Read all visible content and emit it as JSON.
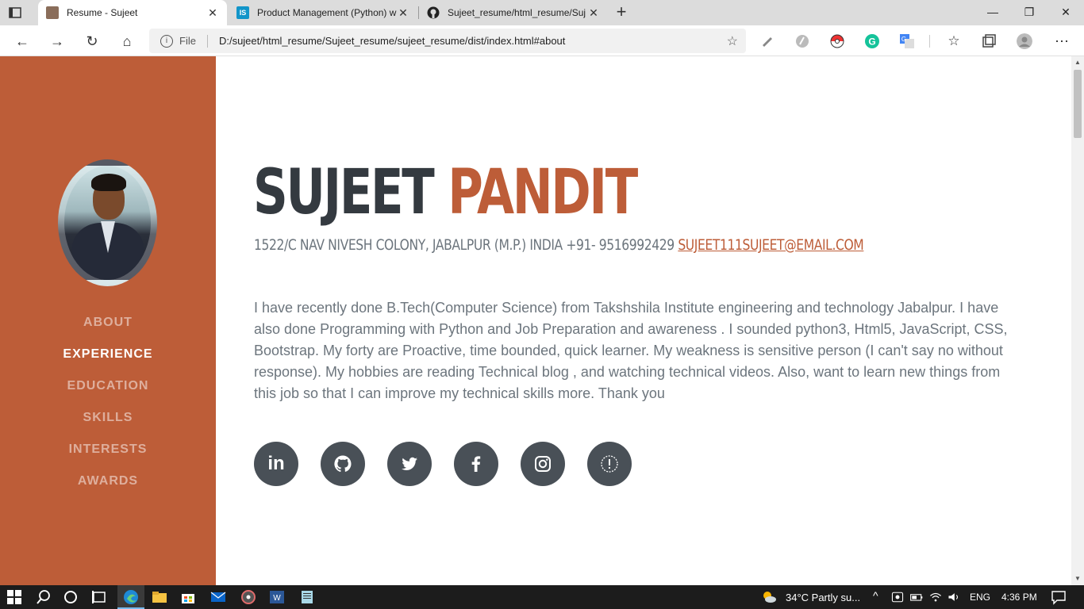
{
  "browser": {
    "tabs": [
      {
        "title": "Resume - Sujeet",
        "active": true
      },
      {
        "title": "Product Management (Python) w",
        "active": false
      },
      {
        "title": "Sujeet_resume/html_resume/Suj",
        "active": false
      }
    ],
    "new_tab": "+",
    "address": {
      "scheme_label": "File",
      "url": "D:/sujeet/html_resume/Sujeet_resume/sujeet_resume/dist/index.html#about"
    },
    "window_controls": {
      "minimize": "—",
      "restore": "❐",
      "close": "✕"
    }
  },
  "sidebar": {
    "nav": [
      {
        "label": "ABOUT",
        "active": false
      },
      {
        "label": "EXPERIENCE",
        "active": true
      },
      {
        "label": "EDUCATION",
        "active": false
      },
      {
        "label": "SKILLS",
        "active": false
      },
      {
        "label": "INTERESTS",
        "active": false
      },
      {
        "label": "AWARDS",
        "active": false
      }
    ]
  },
  "about": {
    "first_name": "SUJEET",
    "last_name": "PANDIT",
    "address": "1522/C NAV NIVESH COLONY, JABALPUR (M.P.) INDIA +91- 9516992429",
    "email": "SUJEET111SUJEET@EMAIL.COM",
    "bio": "I have recently done B.Tech(Computer Science) from Takshshila Institute engineering and technology Jabalpur. I have also done Programming with Python and Job Preparation and awareness . I sounded python3, Html5, JavaScript, CSS, Bootstrap. My forty are Proactive, time bounded, quick learner. My weakness is sensitive person (I can't say no without response). My hobbies are reading Technical blog , and watching technical videos. Also, want to learn new things from this job so that I can improve my technical skills more. Thank you",
    "socials": [
      "linkedin-icon",
      "github-icon",
      "twitter-icon",
      "facebook-icon",
      "instagram-icon",
      "info-icon"
    ]
  },
  "taskbar": {
    "weather": "34°C  Partly su...",
    "language": "ENG",
    "time": "4:36 PM"
  },
  "colors": {
    "sidebar": "#bd5d38",
    "name_dark": "#343a40",
    "social_bg": "#495057",
    "text_muted": "#6c757d"
  }
}
